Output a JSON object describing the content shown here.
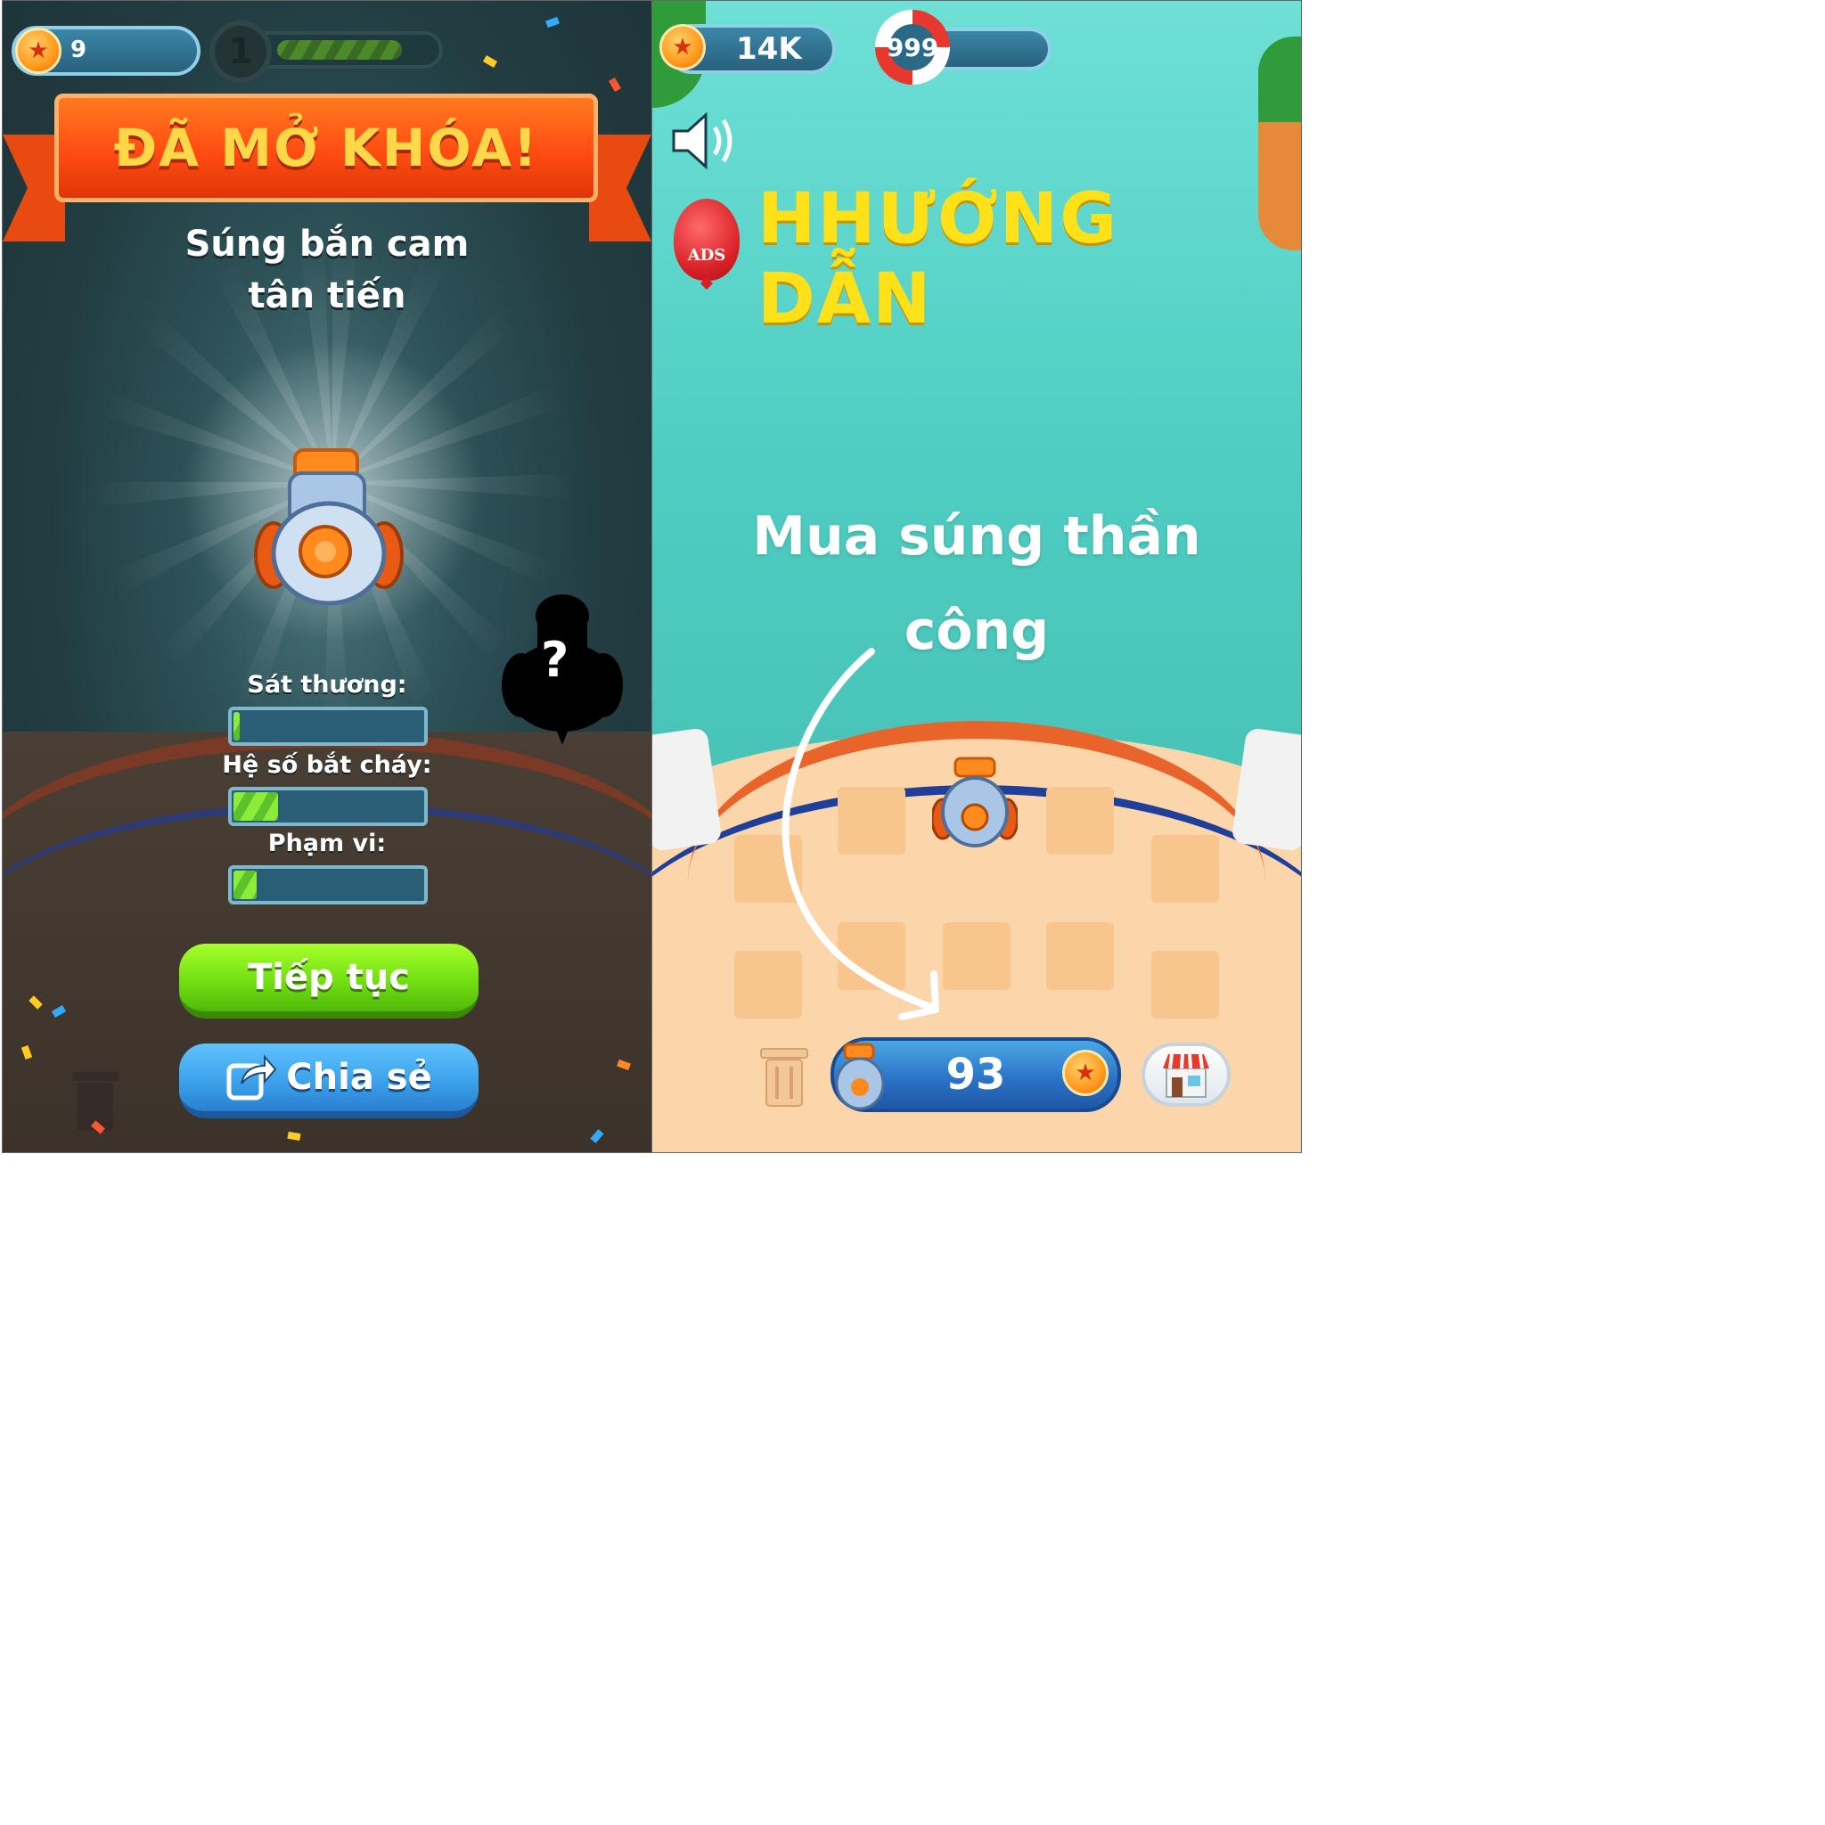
{
  "left_screen": {
    "coins": "9",
    "level": "1",
    "banner_title": "ĐÃ MỞ KHÓA!",
    "weapon_name_line1": "Súng bắn cam",
    "weapon_name_line2": "tân tiến",
    "mystery_mark": "?",
    "stats": [
      {
        "label": "Sát thương:",
        "fill": 0.05
      },
      {
        "label": "Hệ số bắt cháy:",
        "fill": 0.25
      },
      {
        "label": "Phạm vi:",
        "fill": 0.14
      }
    ],
    "continue_label": "Tiếp tục",
    "share_label": "Chia sẻ",
    "icons": [
      "coin-icon",
      "level-badge-icon",
      "cannon-icon",
      "mystery-silhouette-icon",
      "share-icon",
      "trash-icon"
    ],
    "colors": {
      "banner": "#ff4c12",
      "banner_text": "#ffd84a",
      "continue": "#6fdc10",
      "share": "#3a9fe8"
    }
  },
  "right_screen": {
    "coins": "14K",
    "lives": "999",
    "guide_title": "HHƯỚNG DẪN",
    "ads_label": "ADS",
    "instruction_line1": "Mua súng thần",
    "instruction_line2": "công",
    "buy_price": "93",
    "icons": [
      "coin-icon",
      "life-ring-icon",
      "sound-icon",
      "ads-balloon-icon",
      "arrow-icon",
      "trash-icon",
      "cannon-icon",
      "shop-icon"
    ],
    "colors": {
      "title": "#ffe11a",
      "buy_button": "#2a70c4",
      "water": "#4fcdc2",
      "deck": "#fbd6ab"
    }
  }
}
